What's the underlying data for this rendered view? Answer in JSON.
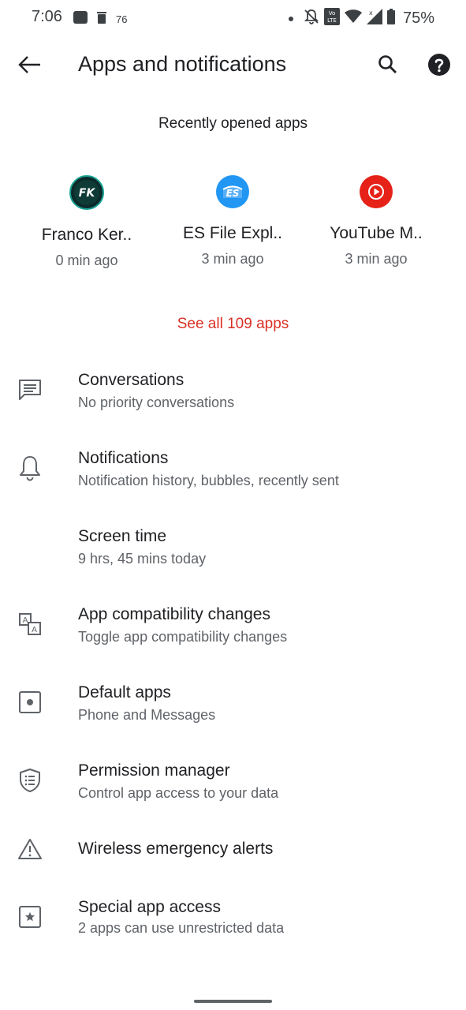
{
  "status_bar": {
    "time": "7:06",
    "notification_count": "76",
    "battery": "75%",
    "icons": [
      "notification-square-icon",
      "trash-icon",
      "dot-icon",
      "bell-off-icon",
      "volte-icon",
      "wifi-icon",
      "signal-icon",
      "battery-icon"
    ]
  },
  "app_bar": {
    "title": "Apps and notifications",
    "back_icon": "arrow-left-icon",
    "search_icon": "search-icon",
    "help_icon": "help-circle-icon"
  },
  "recent": {
    "header": "Recently opened apps",
    "apps": [
      {
        "name": "Franco Ker..",
        "time": "0 min ago",
        "icon": "franco-kernel-icon",
        "color": "#1aa394"
      },
      {
        "name": "ES File Expl..",
        "time": "3 min ago",
        "icon": "es-file-explorer-icon",
        "color": "#2196f3"
      },
      {
        "name": "YouTube M..",
        "time": "3 min ago",
        "icon": "youtube-music-icon",
        "color": "#e62117"
      }
    ],
    "see_all": "See all 109 apps"
  },
  "settings": [
    {
      "title": "Conversations",
      "subtitle": "No priority conversations",
      "icon": "chat-icon"
    },
    {
      "title": "Notifications",
      "subtitle": "Notification history, bubbles, recently sent",
      "icon": "bell-icon"
    },
    {
      "title": "Screen time",
      "subtitle": "9 hrs, 45 mins today",
      "icon": ""
    },
    {
      "title": "App compatibility changes",
      "subtitle": "Toggle app compatibility changes",
      "icon": "translate-icon"
    },
    {
      "title": "Default apps",
      "subtitle": "Phone and Messages",
      "icon": "default-apps-icon"
    },
    {
      "title": "Permission manager",
      "subtitle": "Control app access to your data",
      "icon": "shield-list-icon"
    },
    {
      "title": "Wireless emergency alerts",
      "subtitle": "",
      "icon": "warning-icon"
    },
    {
      "title": "Special app access",
      "subtitle": "2 apps can use unrestricted data",
      "icon": "star-box-icon"
    }
  ],
  "colors": {
    "accent": "#d93025",
    "text_primary": "#202124",
    "text_secondary": "#5f6368"
  }
}
